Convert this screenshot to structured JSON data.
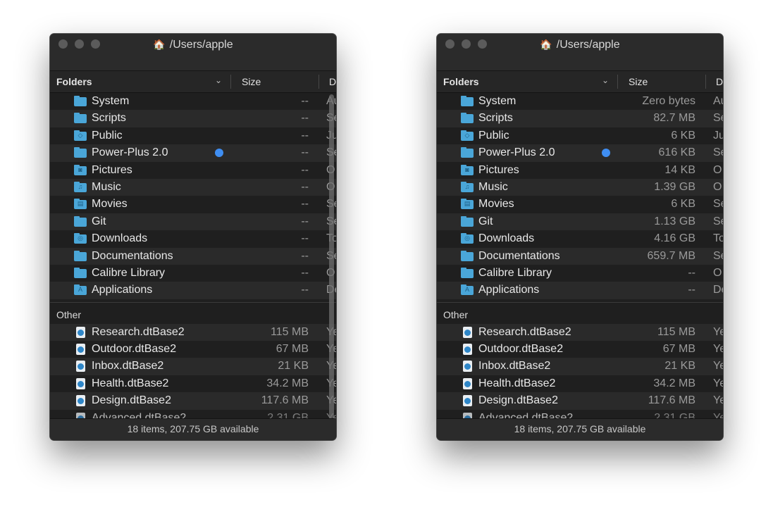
{
  "windows": [
    {
      "title": "/Users/apple",
      "columns": {
        "folders": "Folders",
        "size": "Size",
        "date": "D"
      },
      "folders": [
        {
          "name": "System",
          "size": "--",
          "date": "Au",
          "glyph": ""
        },
        {
          "name": "Scripts",
          "size": "--",
          "date": "Se",
          "glyph": ""
        },
        {
          "name": "Public",
          "size": "--",
          "date": "Ju",
          "glyph": "◇"
        },
        {
          "name": "Power-Plus 2.0",
          "size": "--",
          "date": "Se",
          "glyph": "",
          "tag": true
        },
        {
          "name": "Pictures",
          "size": "--",
          "date": "O",
          "glyph": "◙"
        },
        {
          "name": "Music",
          "size": "--",
          "date": "O",
          "glyph": "♫"
        },
        {
          "name": "Movies",
          "size": "--",
          "date": "Se",
          "glyph": "▤"
        },
        {
          "name": "Git",
          "size": "--",
          "date": "Se",
          "glyph": ""
        },
        {
          "name": "Downloads",
          "size": "--",
          "date": "To",
          "glyph": "◎"
        },
        {
          "name": "Documentations",
          "size": "--",
          "date": "Se",
          "glyph": ""
        },
        {
          "name": "Calibre Library",
          "size": "--",
          "date": "O",
          "glyph": ""
        },
        {
          "name": "Applications",
          "size": "--",
          "date": "De",
          "glyph": "A"
        }
      ],
      "section_other": "Other",
      "files": [
        {
          "name": "Research.dtBase2",
          "size": "115 MB",
          "date": "Ye"
        },
        {
          "name": "Outdoor.dtBase2",
          "size": "67 MB",
          "date": "Ye"
        },
        {
          "name": "Inbox.dtBase2",
          "size": "21 KB",
          "date": "Ye"
        },
        {
          "name": "Health.dtBase2",
          "size": "34.2 MB",
          "date": "Ye"
        },
        {
          "name": "Design.dtBase2",
          "size": "117.6 MB",
          "date": "Ye"
        }
      ],
      "partial_row": {
        "name": "Advanced.dtBase2",
        "size": "2.31 GB",
        "date": "Ye"
      },
      "status": "18 items, 207.75 GB available",
      "scrollbar_visible": true
    },
    {
      "title": "/Users/apple",
      "columns": {
        "folders": "Folders",
        "size": "Size",
        "date": "D"
      },
      "folders": [
        {
          "name": "System",
          "size": "Zero bytes",
          "date": "Au",
          "glyph": ""
        },
        {
          "name": "Scripts",
          "size": "82.7 MB",
          "date": "Se",
          "glyph": ""
        },
        {
          "name": "Public",
          "size": "6 KB",
          "date": "Ju",
          "glyph": "◇"
        },
        {
          "name": "Power-Plus 2.0",
          "size": "616 KB",
          "date": "Se",
          "glyph": "",
          "tag": true
        },
        {
          "name": "Pictures",
          "size": "14 KB",
          "date": "O",
          "glyph": "◙"
        },
        {
          "name": "Music",
          "size": "1.39 GB",
          "date": "O",
          "glyph": "♫"
        },
        {
          "name": "Movies",
          "size": "6 KB",
          "date": "Se",
          "glyph": "▤"
        },
        {
          "name": "Git",
          "size": "1.13 GB",
          "date": "Se",
          "glyph": ""
        },
        {
          "name": "Downloads",
          "size": "4.16 GB",
          "date": "To",
          "glyph": "◎"
        },
        {
          "name": "Documentations",
          "size": "659.7 MB",
          "date": "Se",
          "glyph": ""
        },
        {
          "name": "Calibre Library",
          "size": "--",
          "date": "O",
          "glyph": ""
        },
        {
          "name": "Applications",
          "size": "--",
          "date": "De",
          "glyph": "A"
        }
      ],
      "section_other": "Other",
      "files": [
        {
          "name": "Research.dtBase2",
          "size": "115 MB",
          "date": "Ye"
        },
        {
          "name": "Outdoor.dtBase2",
          "size": "67 MB",
          "date": "Ye"
        },
        {
          "name": "Inbox.dtBase2",
          "size": "21 KB",
          "date": "Ye"
        },
        {
          "name": "Health.dtBase2",
          "size": "34.2 MB",
          "date": "Ye"
        },
        {
          "name": "Design.dtBase2",
          "size": "117.6 MB",
          "date": "Ye"
        }
      ],
      "partial_row": {
        "name": "Advanced.dtBase2",
        "size": "2.31 GB",
        "date": "Ye"
      },
      "status": "18 items, 207.75 GB available",
      "scrollbar_visible": false
    }
  ],
  "colors": {
    "folder_blue": "#4aa6d8",
    "tag_blue": "#3f8ef2",
    "window_bg": "#1f1f1f"
  }
}
